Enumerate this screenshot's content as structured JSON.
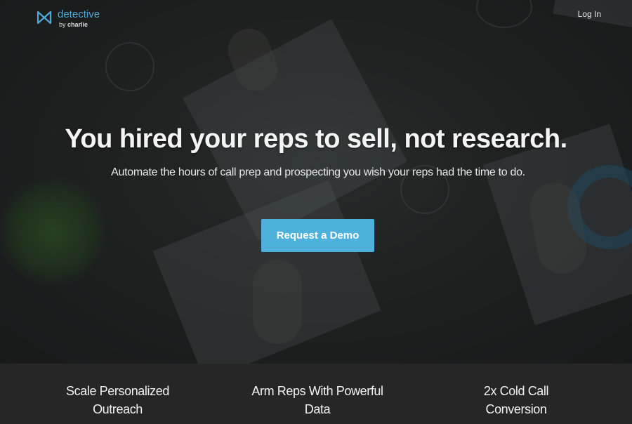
{
  "brand": {
    "name": "detective",
    "sub_prefix": "by",
    "sub_name": "charlie",
    "accent_color": "#4fa9d4",
    "icon": "bowtie-logo-icon"
  },
  "nav": {
    "login_label": "Log In"
  },
  "hero": {
    "headline": "You hired your reps to sell, not research.",
    "subheadline": "Automate the hours of call prep and prospecting you wish your reps had the time to do.",
    "cta_label": "Request a Demo",
    "cta_color": "#4eb1dc"
  },
  "features": [
    {
      "line1": "Scale Personalized",
      "line2": "Outreach"
    },
    {
      "line1": "Arm Reps With Powerful",
      "line2": "Data"
    },
    {
      "line1": "2x Cold Call",
      "line2": "Conversion"
    }
  ]
}
